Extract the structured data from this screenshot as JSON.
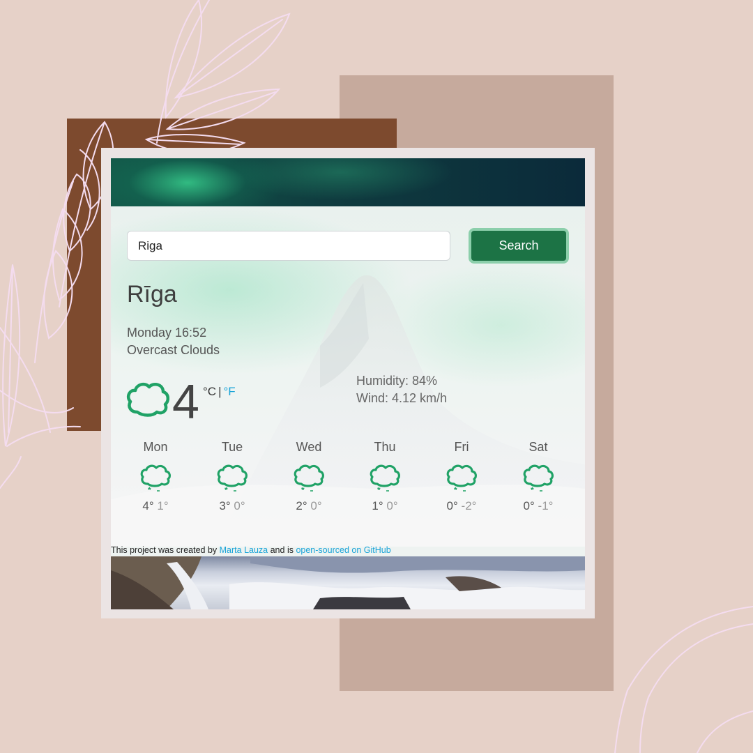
{
  "search": {
    "value": "Riga",
    "button_label": "Search"
  },
  "weather": {
    "city": "Rīga",
    "date_time": "Monday 16:52",
    "description": "Overcast Clouds",
    "temperature": "4",
    "unit_c": "°C",
    "unit_separator": "|",
    "unit_f": "°F",
    "humidity": "Humidity: 84%",
    "wind": "Wind: 4.12 km/h",
    "icon": "cloud-icon"
  },
  "forecast": [
    {
      "day": "Mon",
      "max": "4°",
      "min": "1°",
      "icon": "cloud-snow-icon"
    },
    {
      "day": "Tue",
      "max": "3°",
      "min": "0°",
      "icon": "cloud-snow-icon"
    },
    {
      "day": "Wed",
      "max": "2°",
      "min": "0°",
      "icon": "cloud-snow-icon"
    },
    {
      "day": "Thu",
      "max": "1°",
      "min": "0°",
      "icon": "cloud-snow-icon"
    },
    {
      "day": "Fri",
      "max": "0°",
      "min": "-2°",
      "icon": "cloud-snow-icon"
    },
    {
      "day": "Sat",
      "max": "0°",
      "min": "-1°",
      "icon": "cloud-snow-icon"
    }
  ],
  "footer": {
    "text_before": "This project was created by",
    "author": "Marta Lauza",
    "text_middle": "and is",
    "repo_link": "open-sourced on GitHub"
  },
  "colors": {
    "page_background": "#e6d1c8",
    "accent_green": "#1c7345",
    "icon_green": "#20a266",
    "link_blue": "#1aa4d8",
    "brown_block": "#7d4a2e",
    "taupe_block": "#c6aa9d"
  }
}
